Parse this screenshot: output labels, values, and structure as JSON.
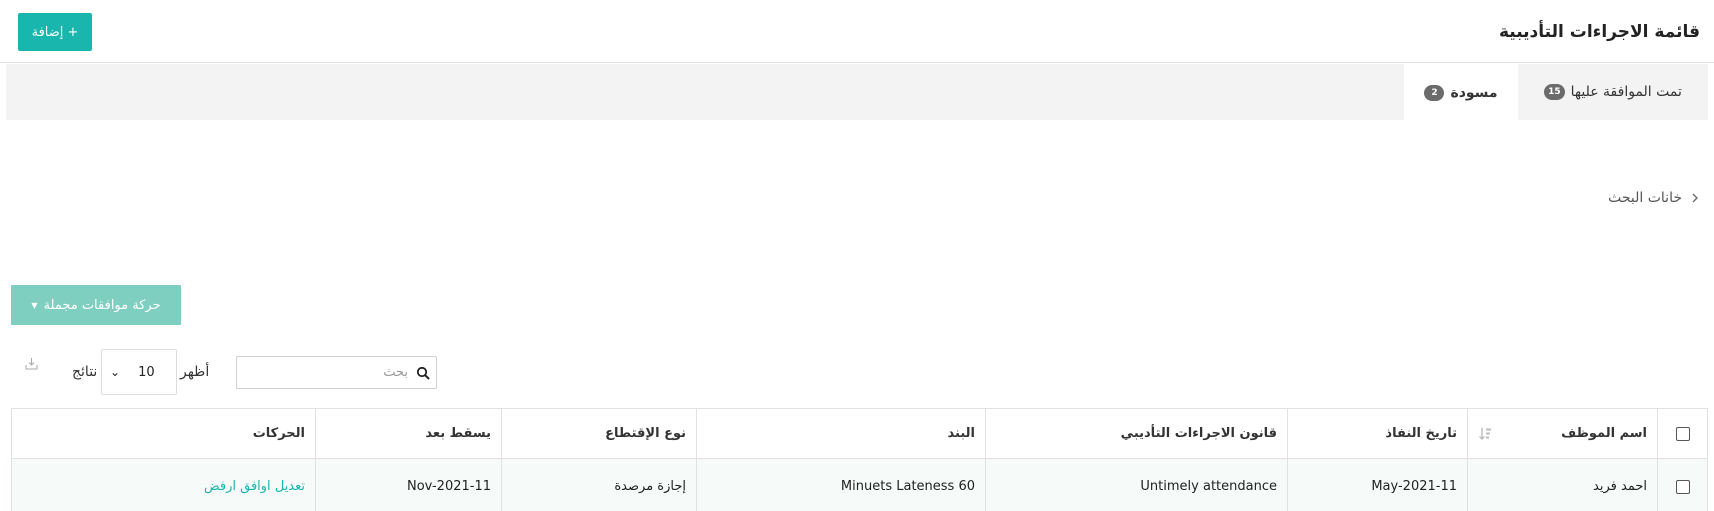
{
  "header": {
    "title": "قائمة الاجراءات التأديبية",
    "add_label": "+ إضافة"
  },
  "tabs": [
    {
      "label": "تمت الموافقة عليها",
      "count": "15"
    },
    {
      "label": "مسودة",
      "count": "2"
    }
  ],
  "search_toggle": {
    "label": "خانات البحث"
  },
  "bulk_action": {
    "label": "حركة موافقات مجملة"
  },
  "toolbar": {
    "search_placeholder": "بحث",
    "show_label": "أظهر",
    "page_size": "10",
    "results_label": "نتائج"
  },
  "table": {
    "columns": [
      "اسم الموظف",
      "تاريخ النفاذ",
      "قانون الاجراءات التأديبي",
      "البند",
      "نوع الإقتطاع",
      "يسقط بعد",
      "الحركات"
    ],
    "rows": [
      {
        "employee": "احمد فريد",
        "effective_date": "May-2021-11",
        "law": "Untimely attendance",
        "clause": "Minuets Lateness 60",
        "deduction_type": "إجازة مرصدة",
        "expires_after": "Nov-2021-11",
        "actions": [
          "تعديل",
          "اوافق",
          "ارفض"
        ]
      }
    ]
  },
  "colors": {
    "accent": "#19b6ad",
    "bulk_button": "#7fcfc0",
    "badge": "#6b6b6b"
  }
}
